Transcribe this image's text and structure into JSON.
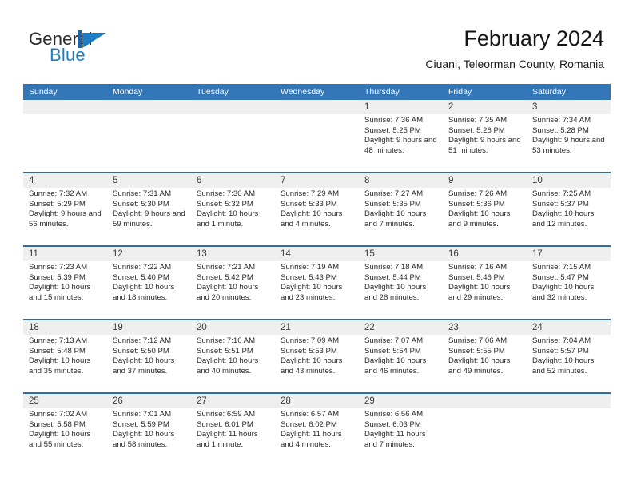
{
  "brand": {
    "name_primary": "General",
    "name_secondary": "Blue",
    "mark": "triangle-flag-icon"
  },
  "header": {
    "month_title": "February 2024",
    "location": "Ciuani, Teleorman County, Romania"
  },
  "colors": {
    "header_blue": "#3276b8",
    "row_divider_blue": "#2d6ca8",
    "daynum_band": "#efefef",
    "brand_blue": "#1f7dc4",
    "text": "#1a1a1a"
  },
  "calendar": {
    "weekdays": [
      "Sunday",
      "Monday",
      "Tuesday",
      "Wednesday",
      "Thursday",
      "Friday",
      "Saturday"
    ],
    "weeks": [
      [
        {
          "day": "",
          "sunrise": "",
          "sunset": "",
          "daylight": ""
        },
        {
          "day": "",
          "sunrise": "",
          "sunset": "",
          "daylight": ""
        },
        {
          "day": "",
          "sunrise": "",
          "sunset": "",
          "daylight": ""
        },
        {
          "day": "",
          "sunrise": "",
          "sunset": "",
          "daylight": ""
        },
        {
          "day": "1",
          "sunrise": "Sunrise: 7:36 AM",
          "sunset": "Sunset: 5:25 PM",
          "daylight": "Daylight: 9 hours and 48 minutes."
        },
        {
          "day": "2",
          "sunrise": "Sunrise: 7:35 AM",
          "sunset": "Sunset: 5:26 PM",
          "daylight": "Daylight: 9 hours and 51 minutes."
        },
        {
          "day": "3",
          "sunrise": "Sunrise: 7:34 AM",
          "sunset": "Sunset: 5:28 PM",
          "daylight": "Daylight: 9 hours and 53 minutes."
        }
      ],
      [
        {
          "day": "4",
          "sunrise": "Sunrise: 7:32 AM",
          "sunset": "Sunset: 5:29 PM",
          "daylight": "Daylight: 9 hours and 56 minutes."
        },
        {
          "day": "5",
          "sunrise": "Sunrise: 7:31 AM",
          "sunset": "Sunset: 5:30 PM",
          "daylight": "Daylight: 9 hours and 59 minutes."
        },
        {
          "day": "6",
          "sunrise": "Sunrise: 7:30 AM",
          "sunset": "Sunset: 5:32 PM",
          "daylight": "Daylight: 10 hours and 1 minute."
        },
        {
          "day": "7",
          "sunrise": "Sunrise: 7:29 AM",
          "sunset": "Sunset: 5:33 PM",
          "daylight": "Daylight: 10 hours and 4 minutes."
        },
        {
          "day": "8",
          "sunrise": "Sunrise: 7:27 AM",
          "sunset": "Sunset: 5:35 PM",
          "daylight": "Daylight: 10 hours and 7 minutes."
        },
        {
          "day": "9",
          "sunrise": "Sunrise: 7:26 AM",
          "sunset": "Sunset: 5:36 PM",
          "daylight": "Daylight: 10 hours and 9 minutes."
        },
        {
          "day": "10",
          "sunrise": "Sunrise: 7:25 AM",
          "sunset": "Sunset: 5:37 PM",
          "daylight": "Daylight: 10 hours and 12 minutes."
        }
      ],
      [
        {
          "day": "11",
          "sunrise": "Sunrise: 7:23 AM",
          "sunset": "Sunset: 5:39 PM",
          "daylight": "Daylight: 10 hours and 15 minutes."
        },
        {
          "day": "12",
          "sunrise": "Sunrise: 7:22 AM",
          "sunset": "Sunset: 5:40 PM",
          "daylight": "Daylight: 10 hours and 18 minutes."
        },
        {
          "day": "13",
          "sunrise": "Sunrise: 7:21 AM",
          "sunset": "Sunset: 5:42 PM",
          "daylight": "Daylight: 10 hours and 20 minutes."
        },
        {
          "day": "14",
          "sunrise": "Sunrise: 7:19 AM",
          "sunset": "Sunset: 5:43 PM",
          "daylight": "Daylight: 10 hours and 23 minutes."
        },
        {
          "day": "15",
          "sunrise": "Sunrise: 7:18 AM",
          "sunset": "Sunset: 5:44 PM",
          "daylight": "Daylight: 10 hours and 26 minutes."
        },
        {
          "day": "16",
          "sunrise": "Sunrise: 7:16 AM",
          "sunset": "Sunset: 5:46 PM",
          "daylight": "Daylight: 10 hours and 29 minutes."
        },
        {
          "day": "17",
          "sunrise": "Sunrise: 7:15 AM",
          "sunset": "Sunset: 5:47 PM",
          "daylight": "Daylight: 10 hours and 32 minutes."
        }
      ],
      [
        {
          "day": "18",
          "sunrise": "Sunrise: 7:13 AM",
          "sunset": "Sunset: 5:48 PM",
          "daylight": "Daylight: 10 hours and 35 minutes."
        },
        {
          "day": "19",
          "sunrise": "Sunrise: 7:12 AM",
          "sunset": "Sunset: 5:50 PM",
          "daylight": "Daylight: 10 hours and 37 minutes."
        },
        {
          "day": "20",
          "sunrise": "Sunrise: 7:10 AM",
          "sunset": "Sunset: 5:51 PM",
          "daylight": "Daylight: 10 hours and 40 minutes."
        },
        {
          "day": "21",
          "sunrise": "Sunrise: 7:09 AM",
          "sunset": "Sunset: 5:53 PM",
          "daylight": "Daylight: 10 hours and 43 minutes."
        },
        {
          "day": "22",
          "sunrise": "Sunrise: 7:07 AM",
          "sunset": "Sunset: 5:54 PM",
          "daylight": "Daylight: 10 hours and 46 minutes."
        },
        {
          "day": "23",
          "sunrise": "Sunrise: 7:06 AM",
          "sunset": "Sunset: 5:55 PM",
          "daylight": "Daylight: 10 hours and 49 minutes."
        },
        {
          "day": "24",
          "sunrise": "Sunrise: 7:04 AM",
          "sunset": "Sunset: 5:57 PM",
          "daylight": "Daylight: 10 hours and 52 minutes."
        }
      ],
      [
        {
          "day": "25",
          "sunrise": "Sunrise: 7:02 AM",
          "sunset": "Sunset: 5:58 PM",
          "daylight": "Daylight: 10 hours and 55 minutes."
        },
        {
          "day": "26",
          "sunrise": "Sunrise: 7:01 AM",
          "sunset": "Sunset: 5:59 PM",
          "daylight": "Daylight: 10 hours and 58 minutes."
        },
        {
          "day": "27",
          "sunrise": "Sunrise: 6:59 AM",
          "sunset": "Sunset: 6:01 PM",
          "daylight": "Daylight: 11 hours and 1 minute."
        },
        {
          "day": "28",
          "sunrise": "Sunrise: 6:57 AM",
          "sunset": "Sunset: 6:02 PM",
          "daylight": "Daylight: 11 hours and 4 minutes."
        },
        {
          "day": "29",
          "sunrise": "Sunrise: 6:56 AM",
          "sunset": "Sunset: 6:03 PM",
          "daylight": "Daylight: 11 hours and 7 minutes."
        },
        {
          "day": "",
          "sunrise": "",
          "sunset": "",
          "daylight": ""
        },
        {
          "day": "",
          "sunrise": "",
          "sunset": "",
          "daylight": ""
        }
      ]
    ]
  }
}
